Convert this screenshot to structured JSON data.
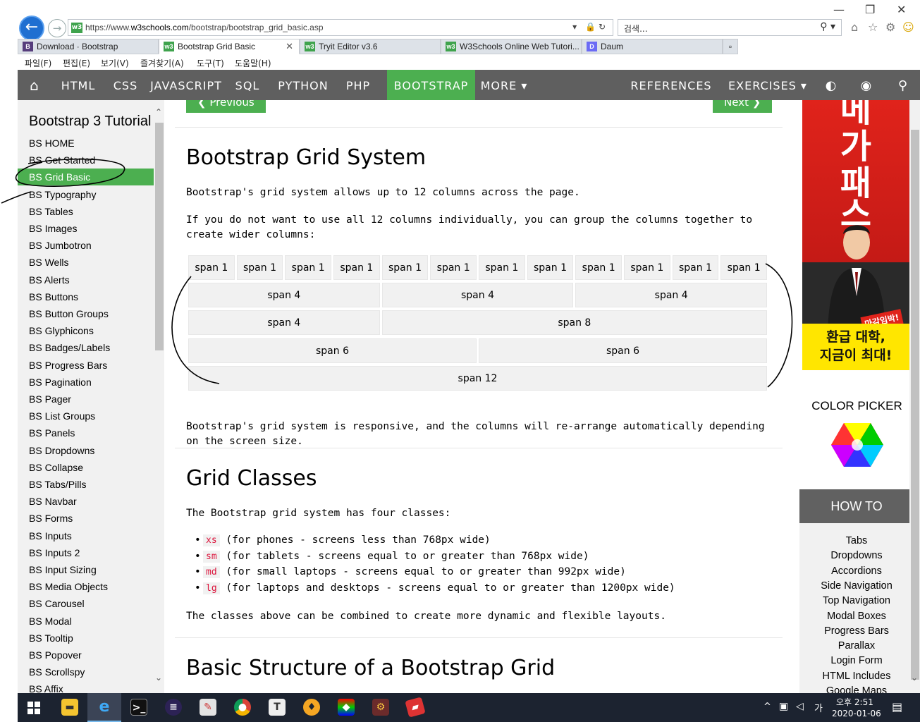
{
  "browser": {
    "url_prefix": "https://www.",
    "url_domain": "w3schools.com",
    "url_path": "/bootstrap/bootstrap_grid_basic.asp",
    "search_placeholder": "검색...",
    "tabs": [
      {
        "label": "Download · Bootstrap",
        "icon": "B",
        "color": "#563d7c"
      },
      {
        "label": "Bootstrap Grid Basic",
        "icon": "w3",
        "color": "#3fa34d",
        "active": true
      },
      {
        "label": "Tryit Editor v3.6",
        "icon": "w3",
        "color": "#3fa34d"
      },
      {
        "label": "W3Schools Online Web Tutori...",
        "icon": "w3",
        "color": "#3fa34d"
      },
      {
        "label": "Daum",
        "icon": "D",
        "color": "#6b6bf5"
      }
    ],
    "menu": [
      "파일(F)",
      "편집(E)",
      "보기(V)",
      "즐겨찾기(A)",
      "도구(T)",
      "도움말(H)"
    ]
  },
  "topnav": {
    "items": [
      "HTML",
      "CSS",
      "JAVASCRIPT",
      "SQL",
      "PYTHON",
      "PHP",
      "BOOTSTRAP",
      "MORE ▾"
    ],
    "active": "BOOTSTRAP",
    "right_items": [
      "REFERENCES ▾",
      "EXERCISES ▾"
    ],
    "accent": "#4caf50"
  },
  "sidebar": {
    "title": "Bootstrap 3 Tutorial",
    "items": [
      "BS HOME",
      "BS Get Started",
      "BS Grid Basic",
      "BS Typography",
      "BS Tables",
      "BS Images",
      "BS Jumbotron",
      "BS Wells",
      "BS Alerts",
      "BS Buttons",
      "BS Button Groups",
      "BS Glyphicons",
      "BS Badges/Labels",
      "BS Progress Bars",
      "BS Pagination",
      "BS Pager",
      "BS List Groups",
      "BS Panels",
      "BS Dropdowns",
      "BS Collapse",
      "BS Tabs/Pills",
      "BS Navbar",
      "BS Forms",
      "BS Inputs",
      "BS Inputs 2",
      "BS Input Sizing",
      "BS Media Objects",
      "BS Carousel",
      "BS Modal",
      "BS Tooltip",
      "BS Popover",
      "BS Scrollspy",
      "BS Affix"
    ],
    "active": "BS Grid Basic"
  },
  "main": {
    "prev_label": "❮ Previous",
    "next_label": "Next ❯",
    "h1_grid_system": "Bootstrap Grid System",
    "p1": "Bootstrap's grid system allows up to 12 columns across the page.",
    "p2": "If you do not want to use all 12 columns individually, you can group the columns together to create wider columns:",
    "grid_rows": [
      [
        "span 1",
        "span 1",
        "span 1",
        "span 1",
        "span 1",
        "span 1",
        "span 1",
        "span 1",
        "span 1",
        "span 1",
        "span 1",
        "span 1"
      ],
      [
        "span 4",
        "span 4",
        "span 4"
      ],
      [
        "span 4",
        "span 8"
      ],
      [
        "span 6",
        "span 6"
      ],
      [
        "span 12"
      ]
    ],
    "p3": "Bootstrap's grid system is responsive, and the columns will re-arrange automatically depending on the screen size.",
    "h1_grid_classes": "Grid Classes",
    "p4": "The Bootstrap grid system has four classes:",
    "classes": [
      {
        "code": "xs",
        "text": "(for phones - screens less than 768px wide)"
      },
      {
        "code": "sm",
        "text": "(for tablets - screens equal to or greater than 768px wide)"
      },
      {
        "code": "md",
        "text": "(for small laptops - screens equal to or greater than 992px wide)"
      },
      {
        "code": "lg",
        "text": "(for laptops and desktops - screens equal to or greater than 1200px wide)"
      }
    ],
    "p5": "The classes above can be combined to create more dynamic and flexible layouts.",
    "h1_basic_structure": "Basic Structure of a Bootstrap Grid"
  },
  "right": {
    "ad_text_top": [
      "메",
      "가",
      "패",
      "스"
    ],
    "ad_badge": "마감임박!",
    "ad_bottom_1": "환급 대학,",
    "ad_bottom_2": "지금이 최대!",
    "color_picker": "COLOR PICKER",
    "howto_title": "HOW TO",
    "howto_items": [
      "Tabs",
      "Dropdowns",
      "Accordions",
      "Side Navigation",
      "Top Navigation",
      "Modal Boxes",
      "Progress Bars",
      "Parallax",
      "Login Form",
      "HTML Includes",
      "Google Maps"
    ]
  },
  "taskbar": {
    "clock_time": "오후 2:51",
    "clock_date": "2020-01-06",
    "ime": "가"
  }
}
